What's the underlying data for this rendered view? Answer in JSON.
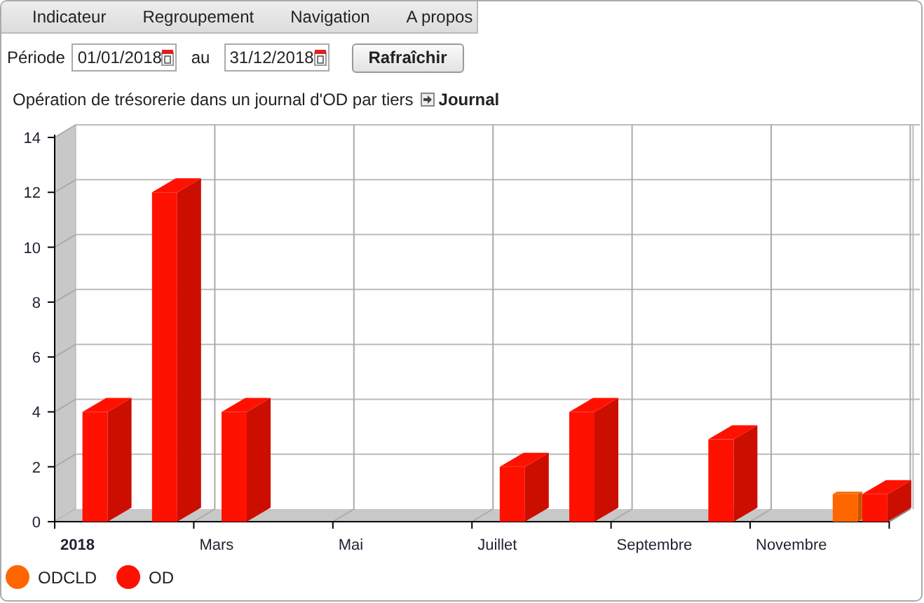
{
  "menu": [
    "Indicateur",
    "Regroupement",
    "Navigation",
    "A propos"
  ],
  "period": {
    "label": "Période",
    "from": "01/01/2018",
    "to_label": "au",
    "to": "31/12/2018"
  },
  "refresh_button": "Rafraîchir",
  "report": {
    "title": "Opération de trésorerie dans un journal d'OD par tiers",
    "link": "Journal"
  },
  "chart": {
    "chart_data": {
      "type": "bar",
      "categories": [
        "2018",
        null,
        "Mars",
        null,
        "Mai",
        null,
        "Juillet",
        null,
        "Septembre",
        null,
        "Novembre",
        null
      ],
      "series": [
        {
          "name": "ODCLD",
          "color": "#ff6600",
          "values": [
            null,
            null,
            null,
            null,
            null,
            null,
            null,
            null,
            null,
            null,
            null,
            1
          ]
        },
        {
          "name": "OD",
          "color": "#ff1100",
          "values": [
            4,
            12,
            4,
            null,
            null,
            null,
            2,
            4,
            null,
            3,
            null,
            1
          ]
        }
      ],
      "ylim": [
        0,
        14
      ],
      "yticks": [
        0,
        2,
        4,
        6,
        8,
        10,
        12,
        14
      ],
      "stacked": false
    }
  }
}
